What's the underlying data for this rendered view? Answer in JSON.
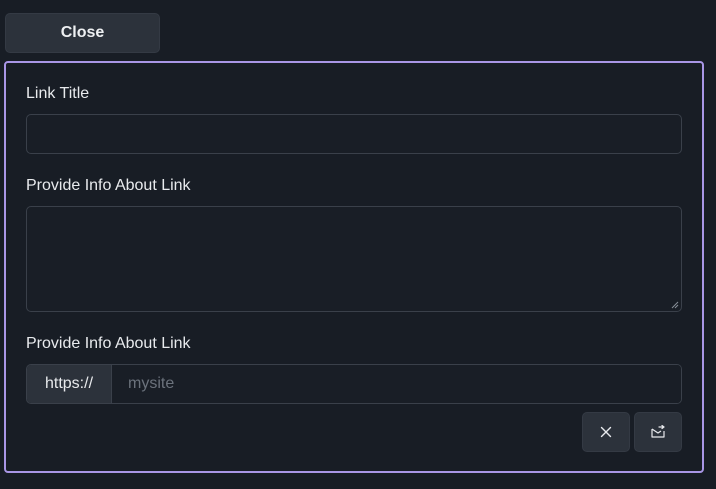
{
  "close_button": {
    "label": "Close"
  },
  "form": {
    "title_label": "Link Title",
    "title_value": "",
    "info_label": "Provide Info About Link",
    "info_value": "",
    "url_label": "Provide Info About Link",
    "url_prefix": "https://",
    "url_placeholder": "mysite",
    "url_value": ""
  },
  "actions": {
    "cancel_icon": "close-x-icon",
    "submit_icon": "send-mail-icon"
  },
  "colors": {
    "panel_border": "#a996e6",
    "background": "#181d25",
    "button_bg": "#2c323b"
  }
}
